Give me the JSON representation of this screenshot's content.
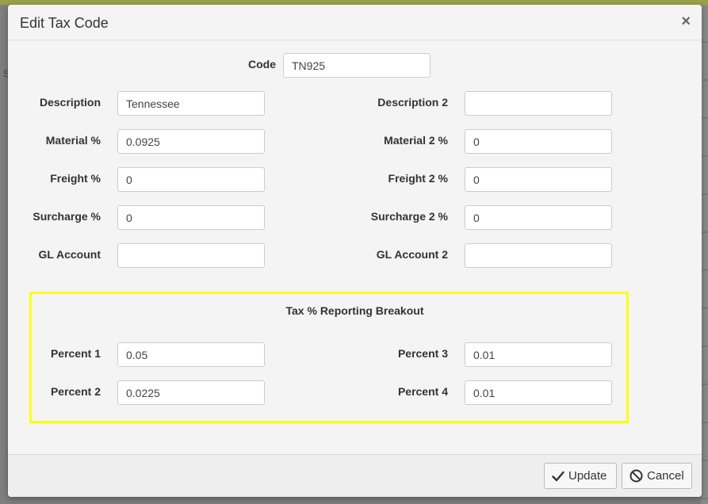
{
  "dialog": {
    "title": "Edit Tax Code",
    "close_symbol": "×"
  },
  "backdrop": {
    "left_char": "S"
  },
  "code": {
    "label": "Code",
    "value": "TN925"
  },
  "left_fields": [
    {
      "label": "Description",
      "value": "Tennessee"
    },
    {
      "label": "Material %",
      "value": "0.0925"
    },
    {
      "label": "Freight %",
      "value": "0"
    },
    {
      "label": "Surcharge %",
      "value": "0"
    },
    {
      "label": "GL Account",
      "value": ""
    }
  ],
  "right_fields": [
    {
      "label": "Description 2",
      "value": ""
    },
    {
      "label": "Material 2 %",
      "value": "0"
    },
    {
      "label": "Freight 2 %",
      "value": "0"
    },
    {
      "label": "Surcharge 2 %",
      "value": "0"
    },
    {
      "label": "GL Account 2",
      "value": ""
    }
  ],
  "breakout": {
    "title": "Tax % Reporting Breakout",
    "left": [
      {
        "label": "Percent 1",
        "value": "0.05"
      },
      {
        "label": "Percent 2",
        "value": "0.0225"
      }
    ],
    "right": [
      {
        "label": "Percent 3",
        "value": "0.01"
      },
      {
        "label": "Percent 4",
        "value": "0.01"
      }
    ],
    "highlight_color": "#ffff00"
  },
  "footer": {
    "update_label": "Update",
    "cancel_label": "Cancel"
  }
}
